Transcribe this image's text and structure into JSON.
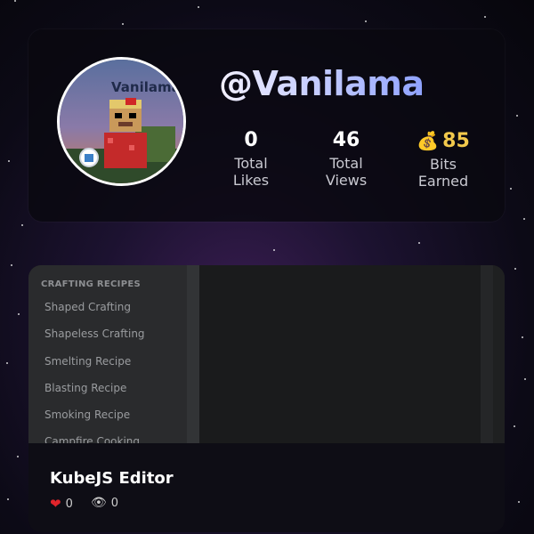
{
  "profile": {
    "username": "@Vanilama",
    "avatar_text": "Vanilama",
    "stats": [
      {
        "value": "0",
        "label_line1": "Total",
        "label_line2": "Likes"
      },
      {
        "value": "46",
        "label_line1": "Total",
        "label_line2": "Views"
      },
      {
        "value": "85",
        "label_line1": "Bits",
        "label_line2": "Earned",
        "icon": "money-bag-icon"
      }
    ]
  },
  "project": {
    "title": "KubeJS Editor",
    "likes": "0",
    "views": "0",
    "preview": {
      "sidebar_heading": "CRAFTING RECIPES",
      "sidebar_items": [
        "Shaped Crafting",
        "Shapeless Crafting",
        "Smelting Recipe",
        "Blasting Recipe",
        "Smoking Recipe",
        "Campfire Cooking"
      ]
    }
  },
  "colors": {
    "bits_accent": "#f2c94c",
    "heart": "#e0242b"
  }
}
